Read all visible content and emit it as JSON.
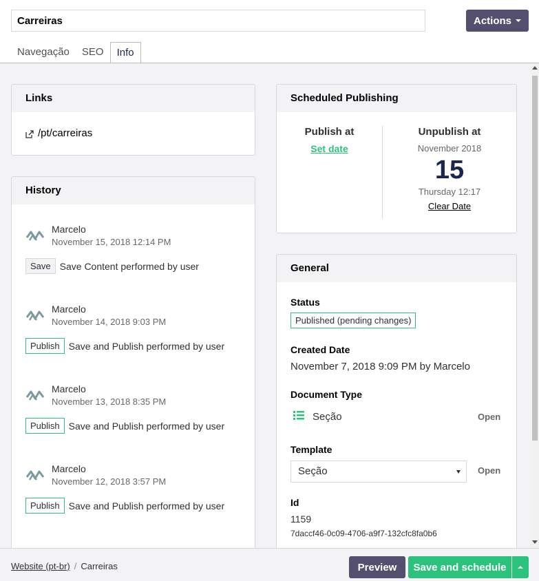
{
  "header": {
    "name_value": "Carreiras",
    "actions_label": "Actions",
    "tabs": [
      {
        "label": "Navegação"
      },
      {
        "label": "SEO"
      },
      {
        "label": "Info"
      }
    ]
  },
  "links": {
    "title": "Links",
    "items": [
      {
        "url": "/pt/carreiras"
      }
    ]
  },
  "history": {
    "title": "History",
    "items": [
      {
        "user": "Marcelo",
        "date": "November 15, 2018 12:14 PM",
        "badge": "Save",
        "action": "Save Content performed by user"
      },
      {
        "user": "Marcelo",
        "date": "November 14, 2018 9:03 PM",
        "badge": "Publish",
        "action": "Save and Publish performed by user"
      },
      {
        "user": "Marcelo",
        "date": "November 13, 2018 8:35 PM",
        "badge": "Publish",
        "action": "Save and Publish performed by user"
      },
      {
        "user": "Marcelo",
        "date": "November 12, 2018 3:57 PM",
        "badge": "Publish",
        "action": "Save and Publish performed by user"
      }
    ]
  },
  "scheduled": {
    "title": "Scheduled Publishing",
    "publish": {
      "label": "Publish at",
      "set_date": "Set date"
    },
    "unpublish": {
      "label": "Unpublish at",
      "month": "November 2018",
      "day": "15",
      "time": "Thursday 12:17",
      "clear": "Clear Date"
    }
  },
  "general": {
    "title": "General",
    "status_label": "Status",
    "status_value": "Published (pending changes)",
    "created_label": "Created Date",
    "created_value": "November 7, 2018 9:09 PM by Marcelo",
    "doctype_label": "Document Type",
    "doctype_value": "Seção",
    "doctype_open": "Open",
    "template_label": "Template",
    "template_value": "Seção",
    "template_open": "Open",
    "id_label": "Id",
    "id_value": "1159",
    "guid_value": "7daccf46-0c09-4706-a9f7-132cfc8fa0b6"
  },
  "footer": {
    "breadcrumb": [
      {
        "label": "Website (pt-br)"
      },
      {
        "label": "Carreiras"
      }
    ],
    "breadcrumb_sep": "/",
    "preview_label": "Preview",
    "save_label": "Save and schedule"
  },
  "colors": {
    "accent_green": "#2bc37c",
    "button_purple": "#544e6f",
    "panel_bg": "#f3f3f5"
  },
  "icons": {
    "link": "external-link-icon",
    "avatar": "user-avatar-icon",
    "doctype": "list-icon"
  }
}
